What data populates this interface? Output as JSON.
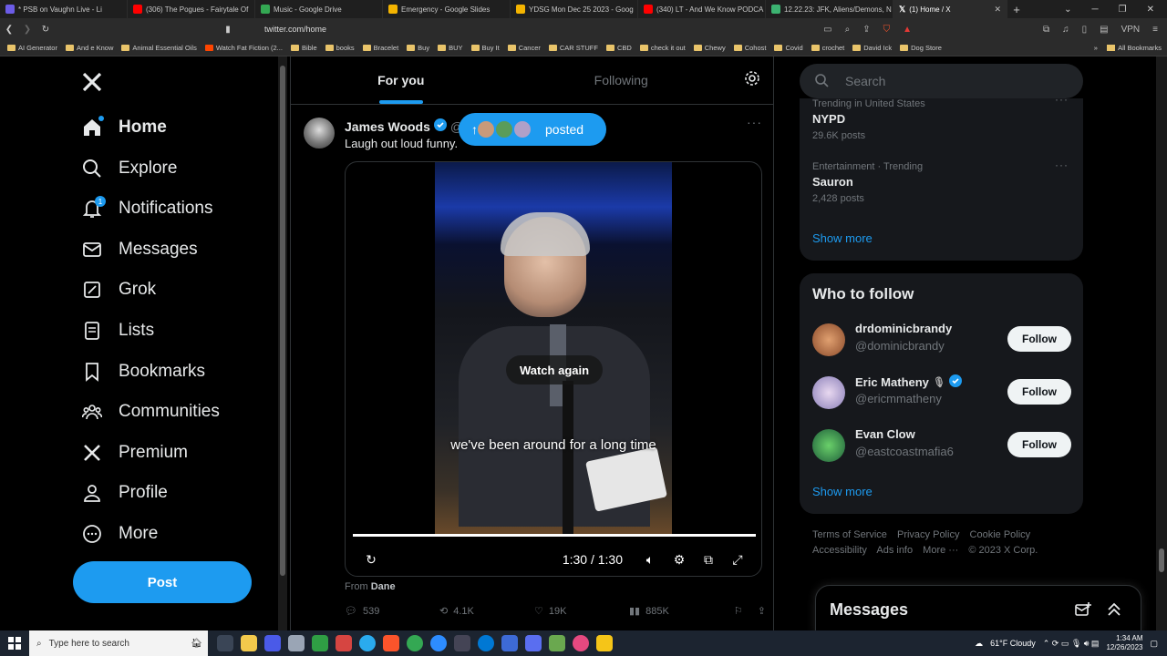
{
  "browser": {
    "tabs": [
      {
        "title": "* PSB on Vaughn Live - Li",
        "color": "#6c5ce7"
      },
      {
        "title": "(306) The Pogues - Fairytale Of",
        "color": "#ff0000"
      },
      {
        "title": "Music - Google Drive",
        "color": "#34a853"
      },
      {
        "title": "Emergency - Google Slides",
        "color": "#f4b400"
      },
      {
        "title": "YDSG Mon Dec 25 2023 - Goog",
        "color": "#f4b400"
      },
      {
        "title": "(340) LT - And We Know PODCA",
        "color": "#ff0000"
      },
      {
        "title": "12.22.23: JFK, Aliens/Demons, N",
        "color": "#3cb371"
      },
      {
        "title": "(1) Home / X",
        "color": "#000000"
      }
    ],
    "url": "twitter.com/home",
    "vpn_label": "VPN",
    "bookmarks": [
      "AI Generator",
      "And e Know",
      "Animal Essential Oils",
      "Watch Fat Fiction (2...",
      "Bible",
      "books",
      "Bracelet",
      "Buy",
      "BUY",
      "Buy It",
      "Cancer",
      "CAR STUFF",
      "CBD",
      "check it out",
      "Chewy",
      "Cohost",
      "Covid",
      "crochet",
      "David Ick",
      "Dog Store"
    ],
    "all_bookmarks": "All Bookmarks"
  },
  "nav": {
    "items": [
      {
        "label": "Home",
        "icon": "home-icon"
      },
      {
        "label": "Explore",
        "icon": "search-icon"
      },
      {
        "label": "Notifications",
        "icon": "bell-icon"
      },
      {
        "label": "Messages",
        "icon": "mail-icon"
      },
      {
        "label": "Grok",
        "icon": "grok-icon"
      },
      {
        "label": "Lists",
        "icon": "list-icon"
      },
      {
        "label": "Bookmarks",
        "icon": "bookmark-icon"
      },
      {
        "label": "Communities",
        "icon": "communities-icon"
      },
      {
        "label": "Premium",
        "icon": "x-icon"
      },
      {
        "label": "Profile",
        "icon": "profile-icon"
      },
      {
        "label": "More",
        "icon": "more-icon"
      }
    ],
    "notifications_count": "1",
    "post_label": "Post"
  },
  "timeline": {
    "tab_for_you": "For you",
    "tab_following": "Following",
    "posted_label": "posted",
    "tweet": {
      "name": "James Woods",
      "handle": "@R",
      "text": "Laugh out loud funny.",
      "subtitle": "we've been around for a long time",
      "watch_again": "Watch again",
      "time": "1:30 / 1:30",
      "from_label": "From",
      "from_name": "Dane",
      "replies": "539",
      "reposts": "4.1K",
      "likes": "19K",
      "views": "885K"
    }
  },
  "right": {
    "search_placeholder": "Search",
    "trends": [
      {
        "category": "Trending in United States",
        "name": "NYPD",
        "count": "29.6K posts"
      },
      {
        "category": "Entertainment · Trending",
        "name": "Sauron",
        "count": "2,428 posts"
      }
    ],
    "show_more": "Show more",
    "who_to_follow_title": "Who to follow",
    "follow_suggestions": [
      {
        "name": "drdominicbrandy",
        "handle": "@dominicbrandy",
        "verified": false,
        "color": "#c0784a"
      },
      {
        "name": "Eric Matheny",
        "handle": "@ericmmatheny",
        "verified": true,
        "color": "#8a7fb8"
      },
      {
        "name": "Evan Clow",
        "handle": "@eastcoastmafia6",
        "verified": false,
        "color": "#2e8b57"
      }
    ],
    "follow_label": "Follow",
    "footer_links": [
      "Terms of Service",
      "Privacy Policy",
      "Cookie Policy",
      "Accessibility",
      "Ads info",
      "More ···",
      "© 2023 X Corp."
    ],
    "messages_title": "Messages"
  },
  "taskbar": {
    "search_placeholder": "Type here to search",
    "weather": "61°F  Cloudy",
    "time": "1:34 AM",
    "date": "12/26/2023"
  },
  "colors": {
    "accent": "#1d9bf0",
    "background": "#000000",
    "panel": "#16181c"
  }
}
